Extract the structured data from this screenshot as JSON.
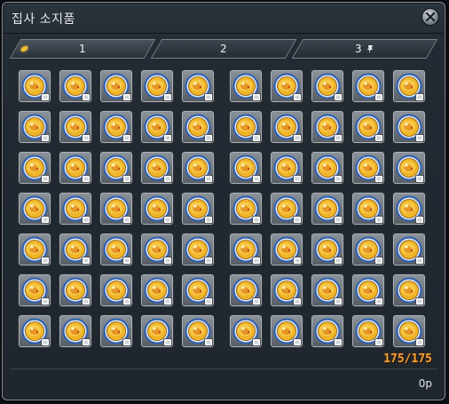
{
  "window": {
    "title": "집사 소지품"
  },
  "tabs": [
    {
      "label": "1",
      "active": true
    },
    {
      "label": "2",
      "active": false
    },
    {
      "label": "3",
      "active": false
    }
  ],
  "inventory": {
    "item": "food-dish-icon",
    "columns": 10,
    "rows": 7,
    "capacity": "175/175"
  },
  "footer": {
    "money": "0p"
  },
  "colors": {
    "capacity": "#f2a23a",
    "tab_indicator": "#f1c232"
  }
}
